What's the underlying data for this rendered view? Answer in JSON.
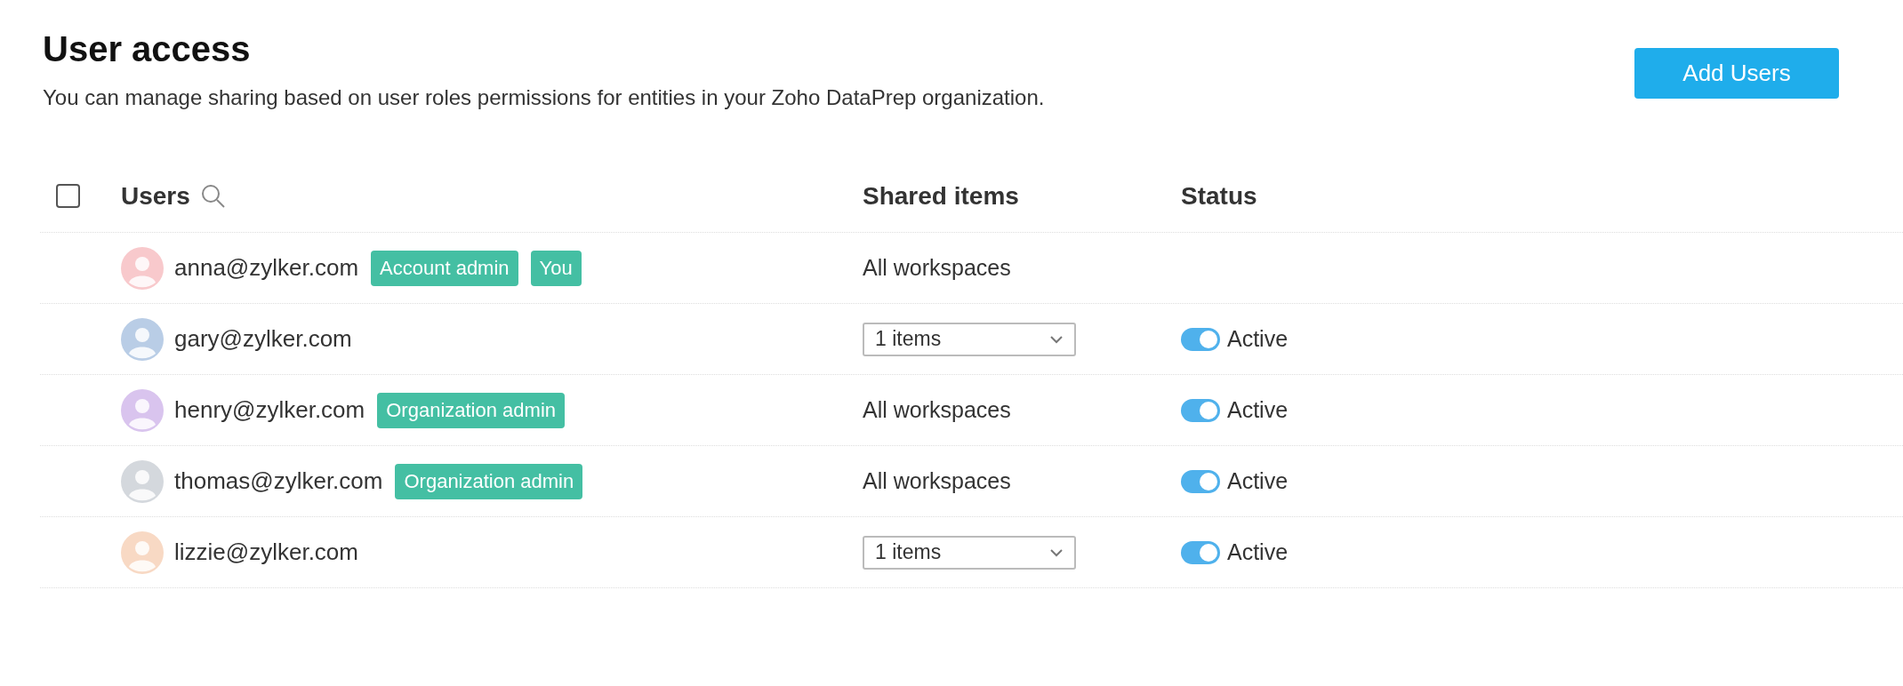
{
  "header": {
    "title": "User access",
    "description": "You can manage sharing based on user roles permissions for entities in your Zoho DataPrep organization.",
    "button": "Add Users"
  },
  "table": {
    "select_all": {
      "checked": false
    },
    "columns": [
      "Users",
      "Shared items",
      "Status"
    ],
    "rows": [
      {
        "email": "anna@zylker.com",
        "color": "#f8c9cc",
        "badges": [
          "Account admin",
          "You"
        ],
        "shared": {
          "kind": "text",
          "value": "All workspaces"
        }
      },
      {
        "email": "gary@zylker.com",
        "color": "#b9cde6",
        "badges": [],
        "shared": {
          "kind": "dropdown",
          "value": "1 items"
        },
        "status": {
          "on": true,
          "label": "Active"
        }
      },
      {
        "email": "henry@zylker.com",
        "color": "#d9c4ee",
        "badges": [
          "Organization admin"
        ],
        "shared": {
          "kind": "text",
          "value": "All workspaces"
        },
        "status": {
          "on": true,
          "label": "Active"
        }
      },
      {
        "email": "thomas@zylker.com",
        "color": "#d4d8dd",
        "badges": [
          "Organization admin"
        ],
        "shared": {
          "kind": "text",
          "value": "All workspaces"
        },
        "status": {
          "on": true,
          "label": "Active"
        }
      },
      {
        "email": "lizzie@zylker.com",
        "color": "#f8d9c4",
        "badges": [],
        "shared": {
          "kind": "dropdown",
          "value": "1 items"
        },
        "status": {
          "on": true,
          "label": "Active"
        }
      }
    ]
  }
}
